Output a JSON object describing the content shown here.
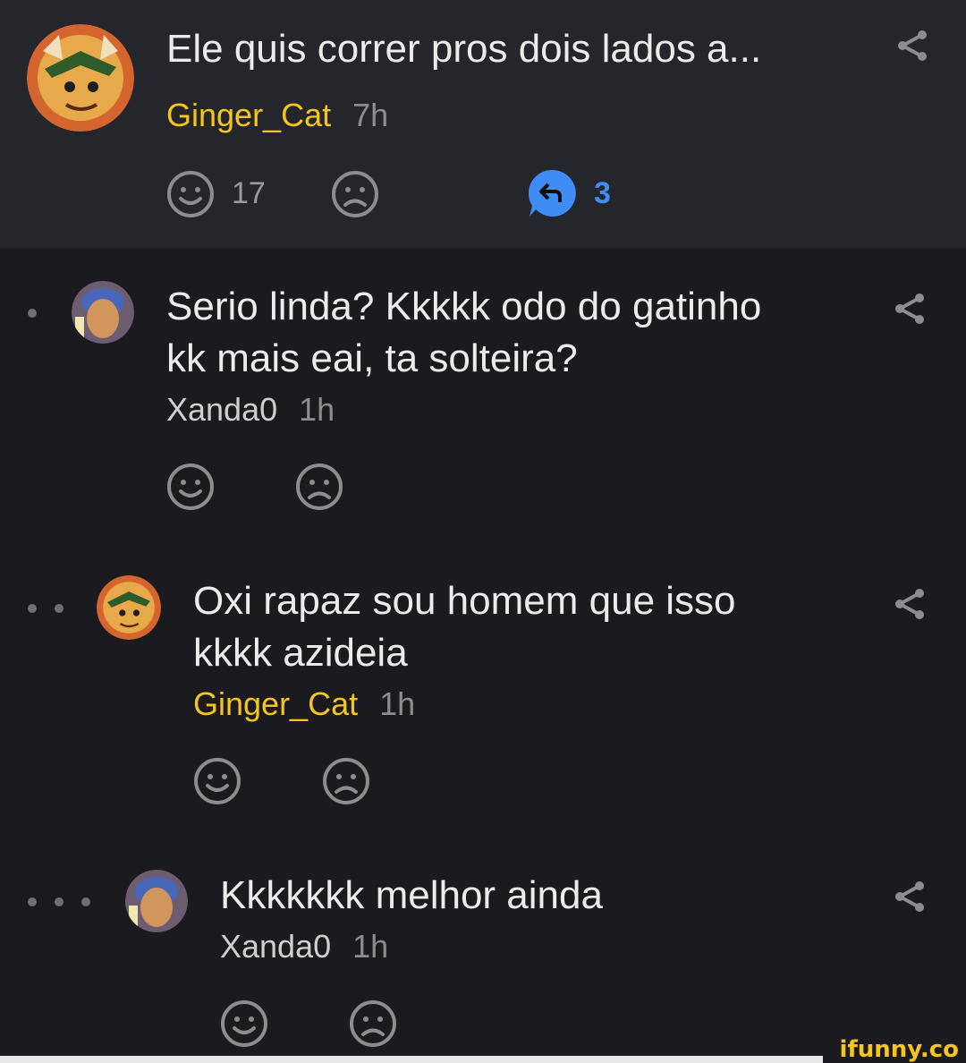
{
  "comments": [
    {
      "text_line1": "Ele quis correr pros dois lados a...",
      "username": "Ginger_Cat",
      "time": "7h",
      "smile_count": "17",
      "replies_count": "3"
    },
    {
      "text_line1": "Serio linda? Kkkkk odo do gatinho",
      "text_line2": "kk mais eai, ta solteira?",
      "username": "Xanda0",
      "time": "1h"
    },
    {
      "text_line1": "Oxi rapaz sou homem que isso",
      "text_line2": "kkkk azideia",
      "username": "Ginger_Cat",
      "time": "1h"
    },
    {
      "text_line1": "Kkkkkkk melhor ainda",
      "username": "Xanda0",
      "time": "1h"
    }
  ],
  "watermark": "ifunny.co",
  "colors": {
    "background": "#1a1a1f",
    "top_background": "#25262b",
    "username_highlight": "#f7c520",
    "reply_accent": "#3f8cf5"
  },
  "icons": [
    "share-icon",
    "smile-icon",
    "frown-icon",
    "reply-bubble-icon"
  ]
}
